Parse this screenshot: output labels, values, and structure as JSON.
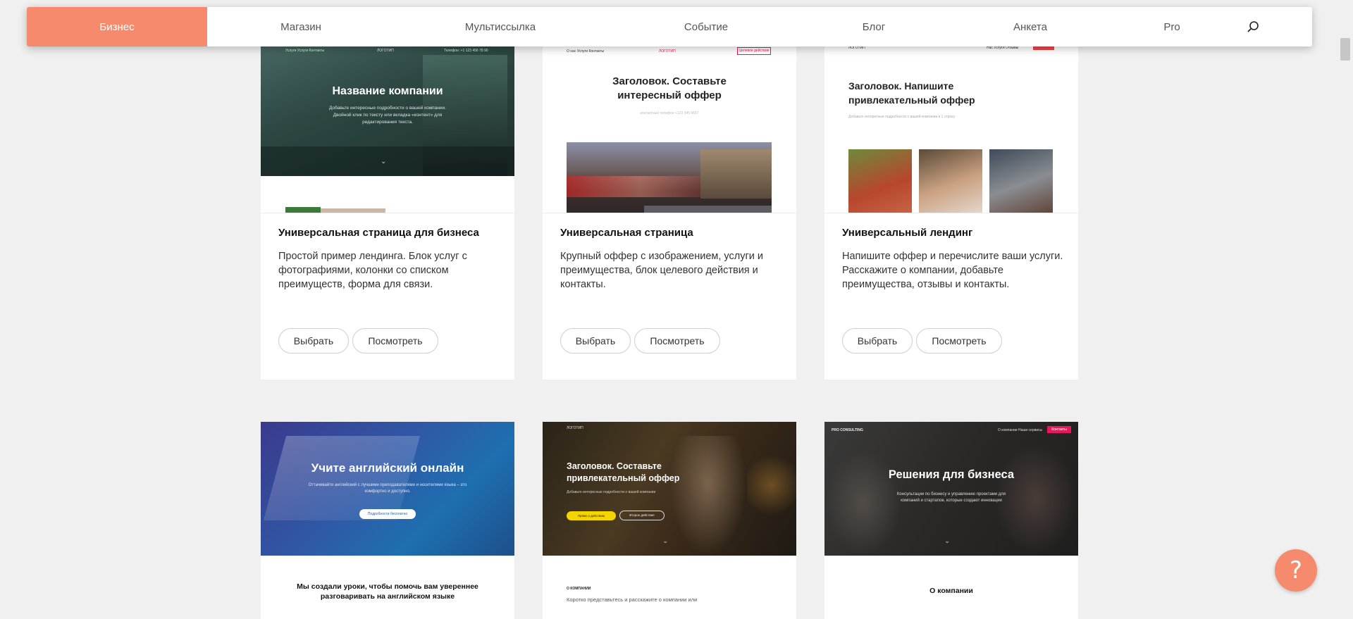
{
  "nav": {
    "tabs": [
      {
        "label": "Бизнес",
        "active": true
      },
      {
        "label": "Магазин"
      },
      {
        "label": "Мультиссылка"
      },
      {
        "label": "Событие"
      },
      {
        "label": "Блог"
      },
      {
        "label": "Анкета"
      },
      {
        "label": "Pro"
      }
    ],
    "search_icon": "search-icon"
  },
  "cards": [
    {
      "title": "Универсальная страница для бизнеса",
      "desc": "Простой пример лендинга. Блок услуг с фотографиями, колонки со списком преимуществ, форма для связи.",
      "select": "Выбрать",
      "view": "Посмотреть",
      "preview": {
        "menu": "Услуги   Услуги   Контакты",
        "logo": "ЛОГОТИП",
        "phone": "Телефон: +1 123 456 78 90",
        "heading": "Название компании",
        "text": "Добавьте интересные подробности о вашей компании. Двойной клик по тексту или вкладка «контент» для редактирования текста."
      }
    },
    {
      "title": "Универсальная страница",
      "desc": "Крупный оффер с изображением, услуги и преимущества, блок целевого действия и контакты.",
      "select": "Выбрать",
      "view": "Посмотреть",
      "preview": {
        "menu": "О нас   Услуги   Контакты",
        "logo": "ЛОГОТИП",
        "cta": "Целевое действие",
        "heading": "Заголовок. Составьте интересный оффер",
        "phone": "контактный телефон +123 345 6667"
      }
    },
    {
      "title": "Универсальный лендинг",
      "desc": "Напишите оффер и перечислите ваши услуги. Расскажите о компании, добавьте преимущества, отзывы и контакты.",
      "select": "Выбрать",
      "view": "Посмотреть",
      "preview": {
        "logo": "ЛОГОТИП",
        "menu": "Нас   Услуги   Отзывы",
        "heading": "Заголовок. Напишите привлекательный оффер",
        "text": "Добавьте интересные подробности о вашей компании в 1 строку"
      }
    },
    {
      "preview": {
        "heading": "Учите английский онлайн",
        "text": "Оттачивайте английский с лучшими преподавателями и носителями языка – это комфортно и доступно.",
        "button": "Подробности бесплатно",
        "subheading": "Мы создали уроки, чтобы помочь вам увереннее разговаривать на английском языке"
      }
    },
    {
      "preview": {
        "logo": "ЛОГОТИП",
        "heading": "Заголовок. Составьте привлекательный оффер",
        "text": "Добавьте интересные подробности о вашей компании",
        "button1": "Прямо к действию",
        "button2": "Второе действие",
        "section": "О КОМПАНИИ",
        "section_text": "Коротко представьтесь и расскажите о компании или"
      }
    },
    {
      "preview": {
        "brand": "PRO CONSULTING",
        "menu": "О компании   Наши сервисы",
        "cta": "Контакты",
        "heading": "Решения для бизнеса",
        "text": "Консультации по бизнесу и управлению проектами для компаний и стартапов, которые создают инновации",
        "section": "О компании"
      }
    }
  ],
  "help_button": "?",
  "colors": {
    "accent": "#f58a6c",
    "cta_pink": "#e8175d",
    "cta_yellow": "#f5d500"
  }
}
